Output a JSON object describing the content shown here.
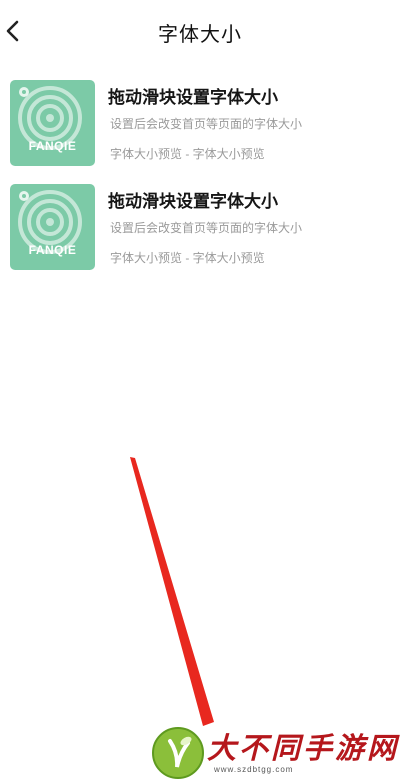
{
  "header": {
    "title": "字体大小",
    "back_icon": "chevron-left-icon"
  },
  "items": [
    {
      "thumbnail_text": "FANQIE",
      "title": "拖动滑块设置字体大小",
      "description": "设置后会改变首页等页面的字体大小",
      "meta": "字体大小预览 - 字体大小预览"
    },
    {
      "thumbnail_text": "FANQIE",
      "title": "拖动滑块设置字体大小",
      "description": "设置后会改变首页等页面的字体大小",
      "meta": "字体大小预览 - 字体大小预览"
    }
  ],
  "watermark": {
    "name": "大不同手游网",
    "url": "www.szdbtgg.com"
  },
  "colors": {
    "thumbnail": "#7ccaa7",
    "annotation_arrow": "#e8281f",
    "watermark_text": "#b5171c"
  }
}
